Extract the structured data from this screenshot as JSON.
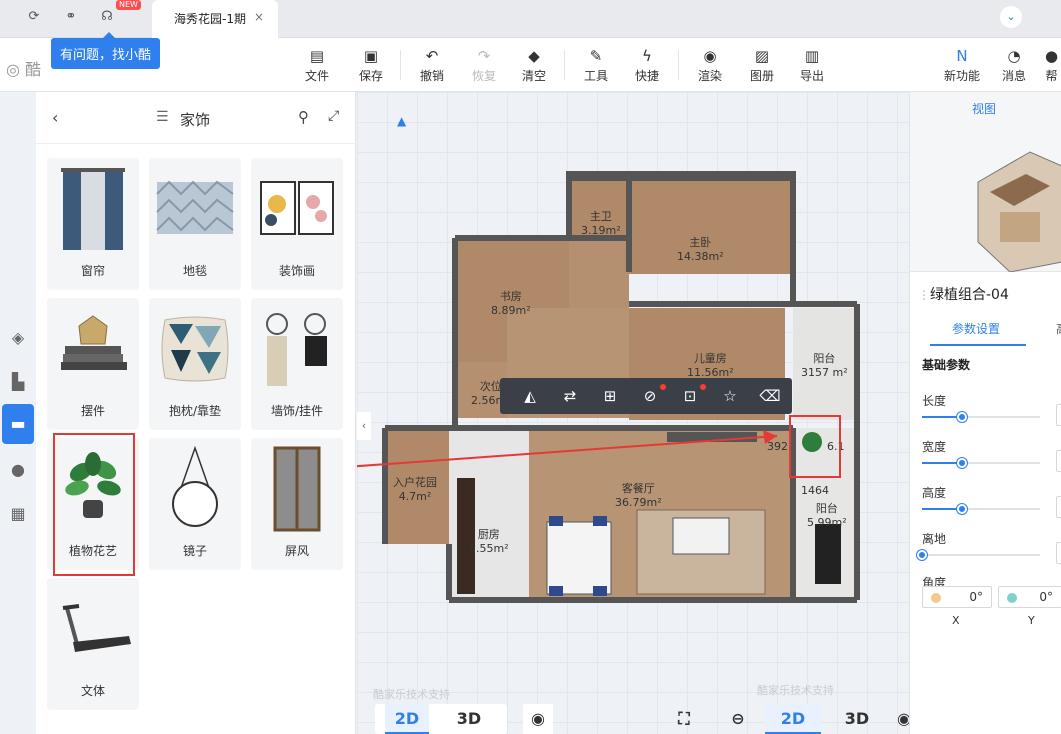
{
  "tabbar": {
    "new_badge": "NEW",
    "tab_title": "海秀花园-1期",
    "tab_close": "×"
  },
  "tooltip": {
    "text": "有问题，找小酷"
  },
  "toolbar": {
    "items": [
      {
        "label": "文件",
        "icon": "file-icon"
      },
      {
        "label": "保存",
        "icon": "save-icon"
      },
      {
        "label": "撤销",
        "icon": "undo-icon"
      },
      {
        "label": "恢复",
        "icon": "redo-icon"
      },
      {
        "label": "清空",
        "icon": "eraser-icon"
      },
      {
        "label": "工具",
        "icon": "wrench-icon"
      },
      {
        "label": "快捷",
        "icon": "lightning-icon"
      },
      {
        "label": "渲染",
        "icon": "camera-icon"
      },
      {
        "label": "图册",
        "icon": "image-icon"
      },
      {
        "label": "导出",
        "icon": "export-icon"
      },
      {
        "label": "新功能",
        "icon": "new-feature-icon"
      },
      {
        "label": "消息",
        "icon": "bell-icon"
      },
      {
        "label": "帮",
        "icon": "help-icon"
      }
    ]
  },
  "panel": {
    "title": "家饰",
    "items": [
      {
        "label": "窗帘"
      },
      {
        "label": "地毯"
      },
      {
        "label": "装饰画"
      },
      {
        "label": "摆件"
      },
      {
        "label": "抱枕/靠垫"
      },
      {
        "label": "墙饰/挂件"
      },
      {
        "label": "植物花艺"
      },
      {
        "label": "镜子"
      },
      {
        "label": "屏风"
      },
      {
        "label": "文体"
      }
    ]
  },
  "floorplan": {
    "rooms": [
      {
        "name": "主卫",
        "area": "3.19m²"
      },
      {
        "name": "主卧",
        "area": "14.38m²"
      },
      {
        "name": "书房",
        "area": "8.89m²"
      },
      {
        "name": "儿童房",
        "area": "11.56m²"
      },
      {
        "name": "阳台",
        "area": "3157 m²"
      },
      {
        "name": "次位",
        "area": "2.56m²"
      },
      {
        "name": "入户花园",
        "area": "4.7m²"
      },
      {
        "name": "客餐厅",
        "area": "36.79m²"
      },
      {
        "name": "厨房",
        "area": "5.55m²"
      },
      {
        "name": "阳台",
        "area": "5.99m²"
      }
    ],
    "dims": {
      "d1": "392",
      "d2": "6.1",
      "d3": "1464"
    }
  },
  "canvas": {
    "watermark": "酷家乐技术支持",
    "view_2d": "2D",
    "view_3d": "3D"
  },
  "rpanel": {
    "view_label": "视图",
    "object_name": "绿植组合-04",
    "tab_params": "参数设置",
    "tab_other": "高",
    "section": "基础参数",
    "sliders": [
      {
        "label": "长度",
        "fill": 0.34
      },
      {
        "label": "宽度",
        "fill": 0.34
      },
      {
        "label": "高度",
        "fill": 0.34
      },
      {
        "label": "离地",
        "fill": 0.0
      }
    ],
    "angle_label": "角度",
    "angle_x": "0°",
    "angle_y": "0°",
    "axis_x": "X",
    "axis_y": "Y"
  },
  "colors": {
    "accent": "#2f80ed",
    "highlight": "#e53935"
  }
}
